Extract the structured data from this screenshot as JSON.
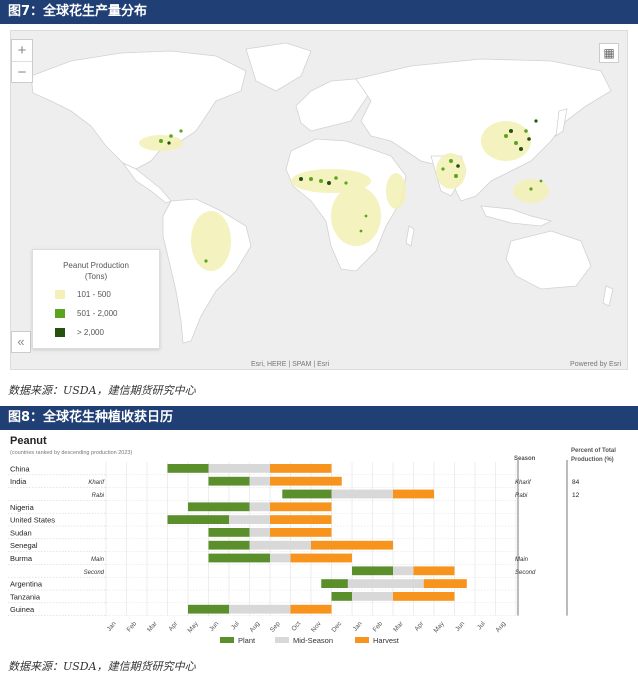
{
  "figure7": {
    "title": "图7：全球花生产量分布",
    "source": "数据来源：USDA，建信期货研究中心",
    "map": {
      "zoom_in": "+",
      "zoom_out": "−",
      "collapse": "«",
      "legend_title": "Peanut Production\n(Tons)",
      "legend_items": [
        {
          "label": "101 - 500",
          "color": "#f3f1b8"
        },
        {
          "label": "501 - 2,000",
          "color": "#5aa41e"
        },
        {
          "label": "> 2,000",
          "color": "#24520e"
        }
      ],
      "attribution": "Esri, HERE | SPAM | Esri",
      "powered_by": "Powered by Esri"
    }
  },
  "figure8": {
    "title": "图8：全球花生种植收获日历",
    "source": "数据来源：USDA，建信期货研究中心",
    "chart_data": {
      "type": "gantt",
      "title": "Peanut",
      "subtitle": "(countries ranked by descending production 2023)",
      "season_header": "Season",
      "percent_header": "Percent of Total Production (%)",
      "months": [
        "Jan",
        "Feb",
        "Mar",
        "Apr",
        "May",
        "Jun",
        "Jul",
        "Aug",
        "Sep",
        "Oct",
        "Nov",
        "Dec",
        "Jan",
        "Feb",
        "Mar",
        "Apr",
        "May",
        "Jun",
        "Jul",
        "Aug"
      ],
      "phase_colors": {
        "plant": "#5a8f2b",
        "mid": "#d8d8d8",
        "harvest": "#f7941d"
      },
      "legend": [
        {
          "key": "plant",
          "label": "Plant"
        },
        {
          "key": "mid",
          "label": "Mid-Season"
        },
        {
          "key": "harvest",
          "label": "Harvest"
        }
      ],
      "rows": [
        {
          "country": "China",
          "season": "",
          "percent": "",
          "plant": [
            3,
            5
          ],
          "mid": [
            5,
            8
          ],
          "harvest": [
            8,
            11
          ]
        },
        {
          "country": "India",
          "season": "Kharif",
          "percent": "84",
          "plant": [
            5,
            7
          ],
          "mid": [
            7,
            8
          ],
          "harvest": [
            8,
            11.5
          ]
        },
        {
          "country": "",
          "season": "Rabi",
          "percent": "12",
          "plant": [
            8.6,
            11
          ],
          "mid": [
            11,
            14
          ],
          "harvest": [
            14,
            16
          ]
        },
        {
          "country": "Nigeria",
          "season": "",
          "percent": "",
          "plant": [
            4,
            7
          ],
          "mid": [
            7,
            8
          ],
          "harvest": [
            8,
            11
          ]
        },
        {
          "country": "United States",
          "season": "",
          "percent": "",
          "plant": [
            3,
            6
          ],
          "mid": [
            6,
            8
          ],
          "harvest": [
            8,
            11
          ]
        },
        {
          "country": "Sudan",
          "season": "",
          "percent": "",
          "plant": [
            5,
            7
          ],
          "mid": [
            7,
            8
          ],
          "harvest": [
            8,
            11
          ]
        },
        {
          "country": "Senegal",
          "season": "",
          "percent": "",
          "plant": [
            5,
            7
          ],
          "mid": [
            7,
            10
          ],
          "harvest": [
            10,
            14
          ]
        },
        {
          "country": "Burma",
          "season": "Main",
          "percent": "",
          "plant": [
            5,
            8
          ],
          "mid": [
            8,
            9
          ],
          "harvest": [
            9,
            12
          ]
        },
        {
          "country": "",
          "season": "Second",
          "percent": "",
          "plant": [
            12,
            14
          ],
          "mid": [
            14,
            15
          ],
          "harvest": [
            15,
            17
          ]
        },
        {
          "country": "Argentina",
          "season": "",
          "percent": "",
          "plant": [
            10.5,
            11.8
          ],
          "mid": [
            11.8,
            15.5
          ],
          "harvest": [
            15.5,
            17.6
          ]
        },
        {
          "country": "Tanzania",
          "season": "",
          "percent": "",
          "plant": [
            11,
            12
          ],
          "mid": [
            12,
            14
          ],
          "harvest": [
            14,
            17
          ]
        },
        {
          "country": "Guinea",
          "season": "",
          "percent": "",
          "plant": [
            4,
            6
          ],
          "mid": [
            6,
            9
          ],
          "harvest": [
            9,
            11
          ]
        }
      ]
    }
  }
}
